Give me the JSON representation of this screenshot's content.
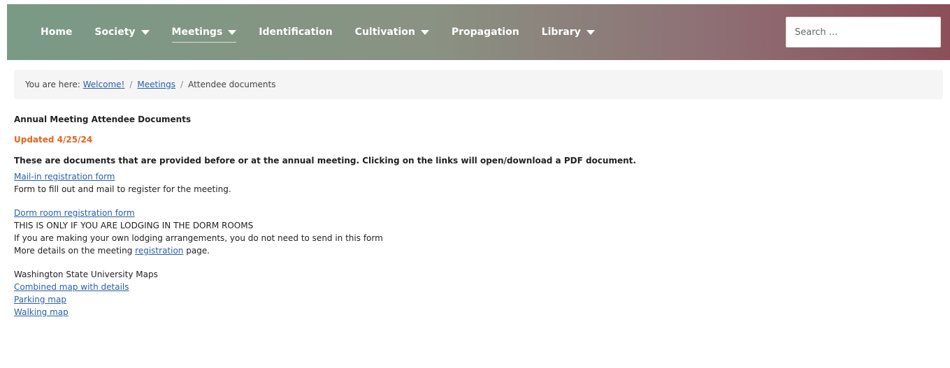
{
  "nav": {
    "items": [
      {
        "label": "Home",
        "dropdown": false
      },
      {
        "label": "Society",
        "dropdown": true
      },
      {
        "label": "Meetings",
        "dropdown": true
      },
      {
        "label": "Identification",
        "dropdown": false
      },
      {
        "label": "Cultivation",
        "dropdown": true
      },
      {
        "label": "Propagation",
        "dropdown": false
      },
      {
        "label": "Library",
        "dropdown": true
      }
    ],
    "active_item": "Meetings",
    "search_placeholder": "Search ..."
  },
  "breadcrumb": {
    "prefix": "You are here:",
    "links": [
      "Welcome!",
      "Meetings"
    ],
    "current": "Attendee documents",
    "separator": "/"
  },
  "content": {
    "title": "Annual Meeting Attendee Documents",
    "updated": "Updated 4/25/24",
    "intro": "These are documents that are provided before or at the annual meeting. Clicking on the links will open/download a PDF document.",
    "mailin_link": "Mail-in registration form",
    "mailin_desc": "Form to fill out and mail to register for the meeting.",
    "dorm_link": "Dorm room registration form",
    "dorm_line1": "THIS IS ONLY IF YOU ARE LODGING IN THE DORM ROOMS",
    "dorm_line2": "If you are making your own lodging arrangements, you do not need to send in this form",
    "dorm_line3_pre": "More details on the meeting",
    "dorm_line3_link": "registration",
    "dorm_line3_post": "page.",
    "maps_heading": "Washington State University Maps",
    "map_links": [
      "Combined map with details",
      "Parking map",
      "Walking map"
    ]
  },
  "colors": {
    "nav_gradient_start": "#7a9a86",
    "nav_gradient_end": "#8c4f5a",
    "link": "#2a5fa8",
    "updated": "#e8631a"
  }
}
